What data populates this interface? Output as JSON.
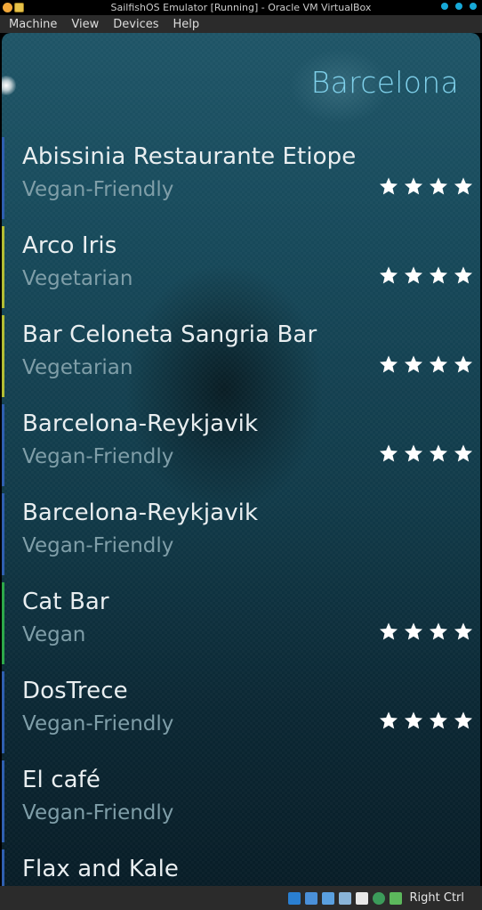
{
  "window": {
    "title": "SailfishOS Emulator [Running] - Oracle VM VirtualBox"
  },
  "menu": [
    "Machine",
    "View",
    "Devices",
    "Help"
  ],
  "app": {
    "header": "Barcelona",
    "restaurants": [
      {
        "name": "Abissinia Restaurante Etiope",
        "category": "Vegan-Friendly",
        "rating": 4,
        "color": "#2f5fb0"
      },
      {
        "name": "Arco Iris",
        "category": "Vegetarian",
        "rating": 4,
        "color": "#b3bd34"
      },
      {
        "name": "Bar Celoneta Sangria Bar",
        "category": "Vegetarian",
        "rating": 4,
        "color": "#b3bd34"
      },
      {
        "name": "Barcelona-Reykjavik",
        "category": "Vegan-Friendly",
        "rating": 4,
        "color": "#2f5fb0"
      },
      {
        "name": "Barcelona-Reykjavik",
        "category": "Vegan-Friendly",
        "rating": 0,
        "color": "#2f5fb0"
      },
      {
        "name": "Cat Bar",
        "category": "Vegan",
        "rating": 4,
        "color": "#2da84a"
      },
      {
        "name": "DosTrece",
        "category": "Vegan-Friendly",
        "rating": 4,
        "color": "#2f5fb0"
      },
      {
        "name": "El café",
        "category": "Vegan-Friendly",
        "rating": 0,
        "color": "#2f5fb0"
      },
      {
        "name": "Flax and Kale",
        "category": "",
        "rating": 0,
        "color": "#2f5fb0"
      }
    ]
  },
  "statusbar": {
    "host_key": "Right Ctrl"
  }
}
